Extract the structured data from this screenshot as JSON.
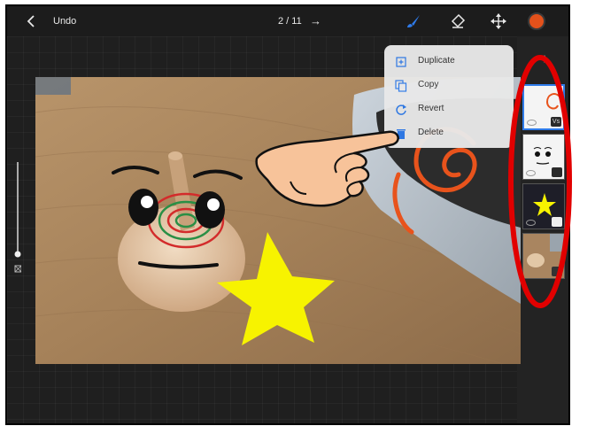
{
  "topbar": {
    "undo_label": "Undo",
    "page_counter": "2 / 11",
    "next_glyph": "→",
    "back_icon": "chevron-left-icon",
    "brush_icon": "brush-icon",
    "eraser_icon": "eraser-icon",
    "move_icon": "move-icon",
    "color_swatch": "#e3511b"
  },
  "menu": {
    "items": [
      {
        "label": "Duplicate",
        "icon": "duplicate-icon"
      },
      {
        "label": "Copy",
        "icon": "copy-icon"
      },
      {
        "label": "Revert",
        "icon": "revert-icon"
      },
      {
        "label": "Delete",
        "icon": "trash-icon"
      }
    ]
  },
  "layers": {
    "add_glyph": "+",
    "thumbnails": [
      {
        "name": "layer-spiral",
        "selected": true,
        "badge_text": "Vs"
      },
      {
        "name": "layer-face"
      },
      {
        "name": "layer-star"
      },
      {
        "name": "layer-photo"
      }
    ]
  },
  "colors": {
    "accent": "#2f7bea",
    "annotation_red": "#e10000",
    "star_yellow": "#f7f300",
    "spiral_orange": "#e8531c"
  }
}
